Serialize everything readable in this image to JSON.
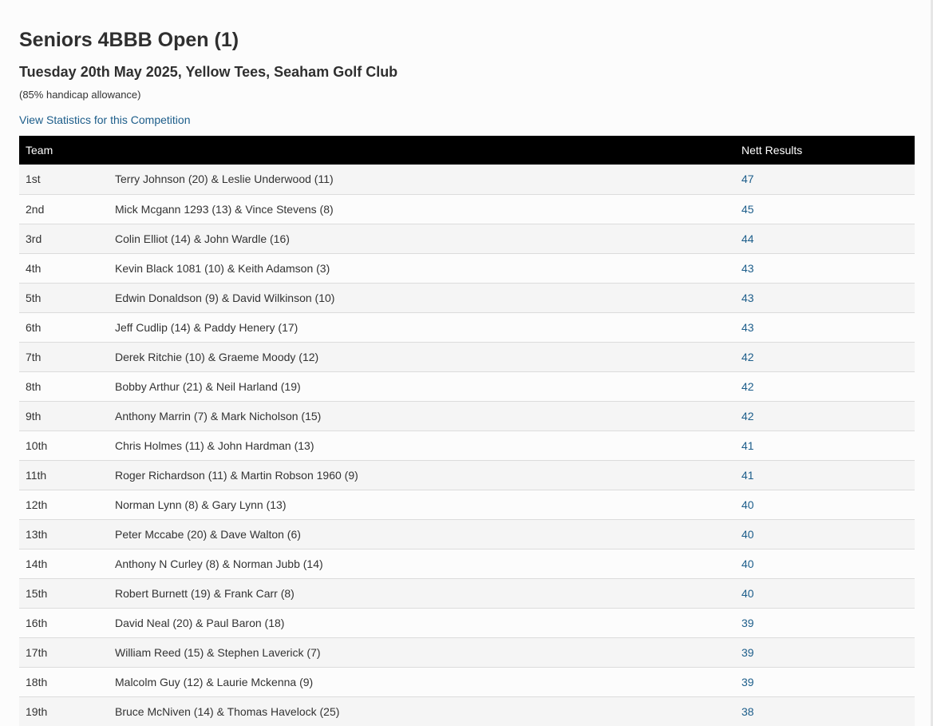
{
  "competition": {
    "title": "Seniors 4BBB Open (1)",
    "subtitle": "Tuesday 20th May 2025, Yellow Tees, Seaham Golf Club",
    "allowance": "(85% handicap allowance)",
    "stats_link": "View Statistics for this Competition"
  },
  "table": {
    "headers": {
      "team": "Team",
      "results": "Nett Results"
    },
    "rows": [
      {
        "position": "1st",
        "team": "Terry Johnson (20) & Leslie Underwood (11)",
        "result": "47"
      },
      {
        "position": "2nd",
        "team": "Mick Mcgann 1293 (13) & Vince Stevens (8)",
        "result": "45"
      },
      {
        "position": "3rd",
        "team": "Colin Elliot (14) & John Wardle (16)",
        "result": "44"
      },
      {
        "position": "4th",
        "team": "Kevin Black 1081 (10) & Keith Adamson (3)",
        "result": "43"
      },
      {
        "position": "5th",
        "team": "Edwin Donaldson (9) & David Wilkinson (10)",
        "result": "43"
      },
      {
        "position": "6th",
        "team": "Jeff Cudlip (14) & Paddy Henery (17)",
        "result": "43"
      },
      {
        "position": "7th",
        "team": "Derek Ritchie (10) & Graeme Moody (12)",
        "result": "42"
      },
      {
        "position": "8th",
        "team": "Bobby Arthur (21) & Neil Harland (19)",
        "result": "42"
      },
      {
        "position": "9th",
        "team": "Anthony Marrin (7) & Mark Nicholson (15)",
        "result": "42"
      },
      {
        "position": "10th",
        "team": "Chris Holmes (11) & John Hardman (13)",
        "result": "41"
      },
      {
        "position": "11th",
        "team": "Roger Richardson (11) & Martin Robson 1960 (9)",
        "result": "41"
      },
      {
        "position": "12th",
        "team": "Norman Lynn (8) & Gary Lynn (13)",
        "result": "40"
      },
      {
        "position": "13th",
        "team": "Peter Mccabe (20) & Dave Walton (6)",
        "result": "40"
      },
      {
        "position": "14th",
        "team": "Anthony N Curley (8) & Norman Jubb (14)",
        "result": "40"
      },
      {
        "position": "15th",
        "team": "Robert Burnett (19) & Frank Carr (8)",
        "result": "40"
      },
      {
        "position": "16th",
        "team": "David Neal (20) & Paul Baron (18)",
        "result": "39"
      },
      {
        "position": "17th",
        "team": "William Reed (15) & Stephen Laverick (7)",
        "result": "39"
      },
      {
        "position": "18th",
        "team": "Malcolm Guy (12) & Laurie Mckenna (9)",
        "result": "39"
      },
      {
        "position": "19th",
        "team": "Bruce McNiven (14) & Thomas Havelock (25)",
        "result": "38"
      }
    ]
  }
}
